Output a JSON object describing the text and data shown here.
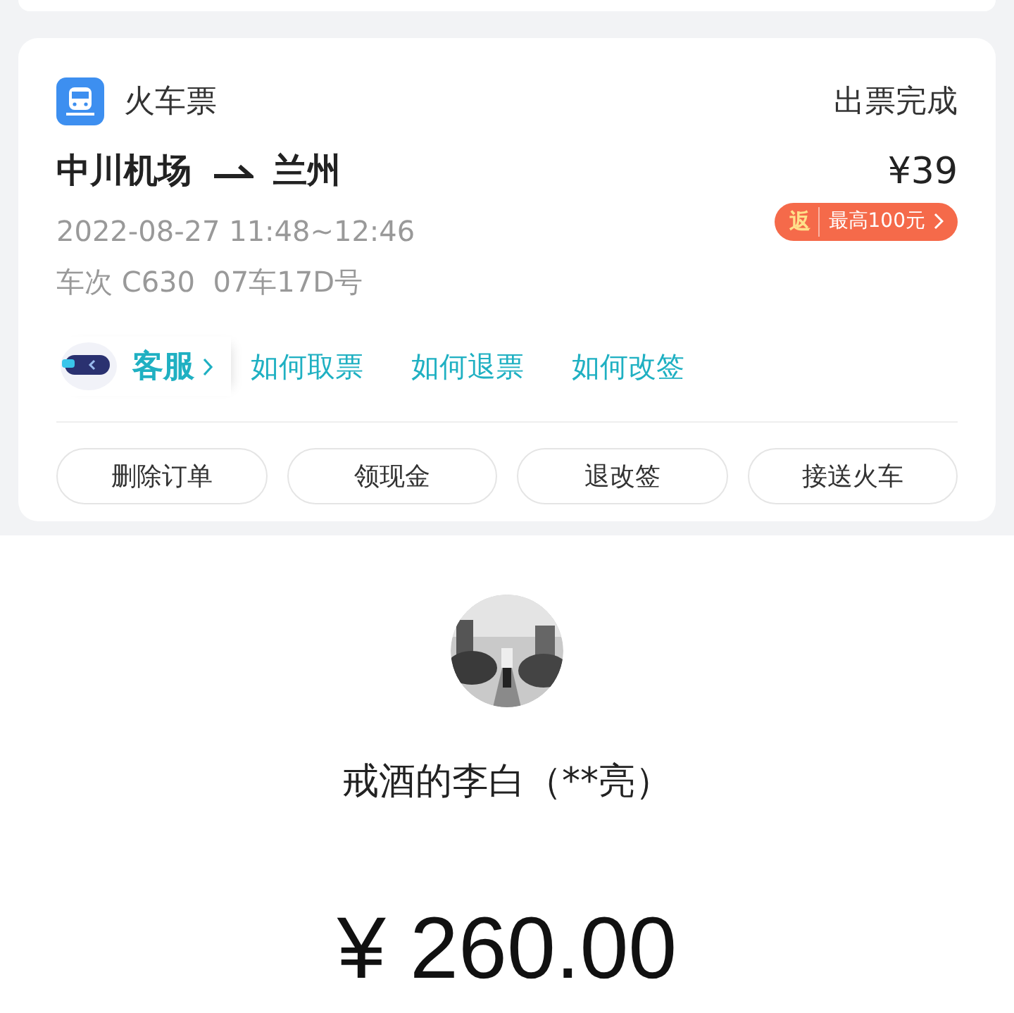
{
  "order_card": {
    "category": "火车票",
    "status": "出票完成",
    "route": {
      "from": "中川机场",
      "to": "兰州"
    },
    "price": "¥39",
    "rebate": {
      "tag": "返",
      "text": "最高100元"
    },
    "datetime": "2022-08-27 11:48~12:46",
    "train_info": "车次 C630  07车17D号",
    "service": {
      "label": "客服"
    },
    "help_links": [
      "如何取票",
      "如何退票",
      "如何改签"
    ],
    "actions": [
      "删除订单",
      "领现金",
      "退改签",
      "接送火车"
    ]
  },
  "payment": {
    "payee": "戒酒的李白（**亮）",
    "amount": "¥ 260.00"
  }
}
